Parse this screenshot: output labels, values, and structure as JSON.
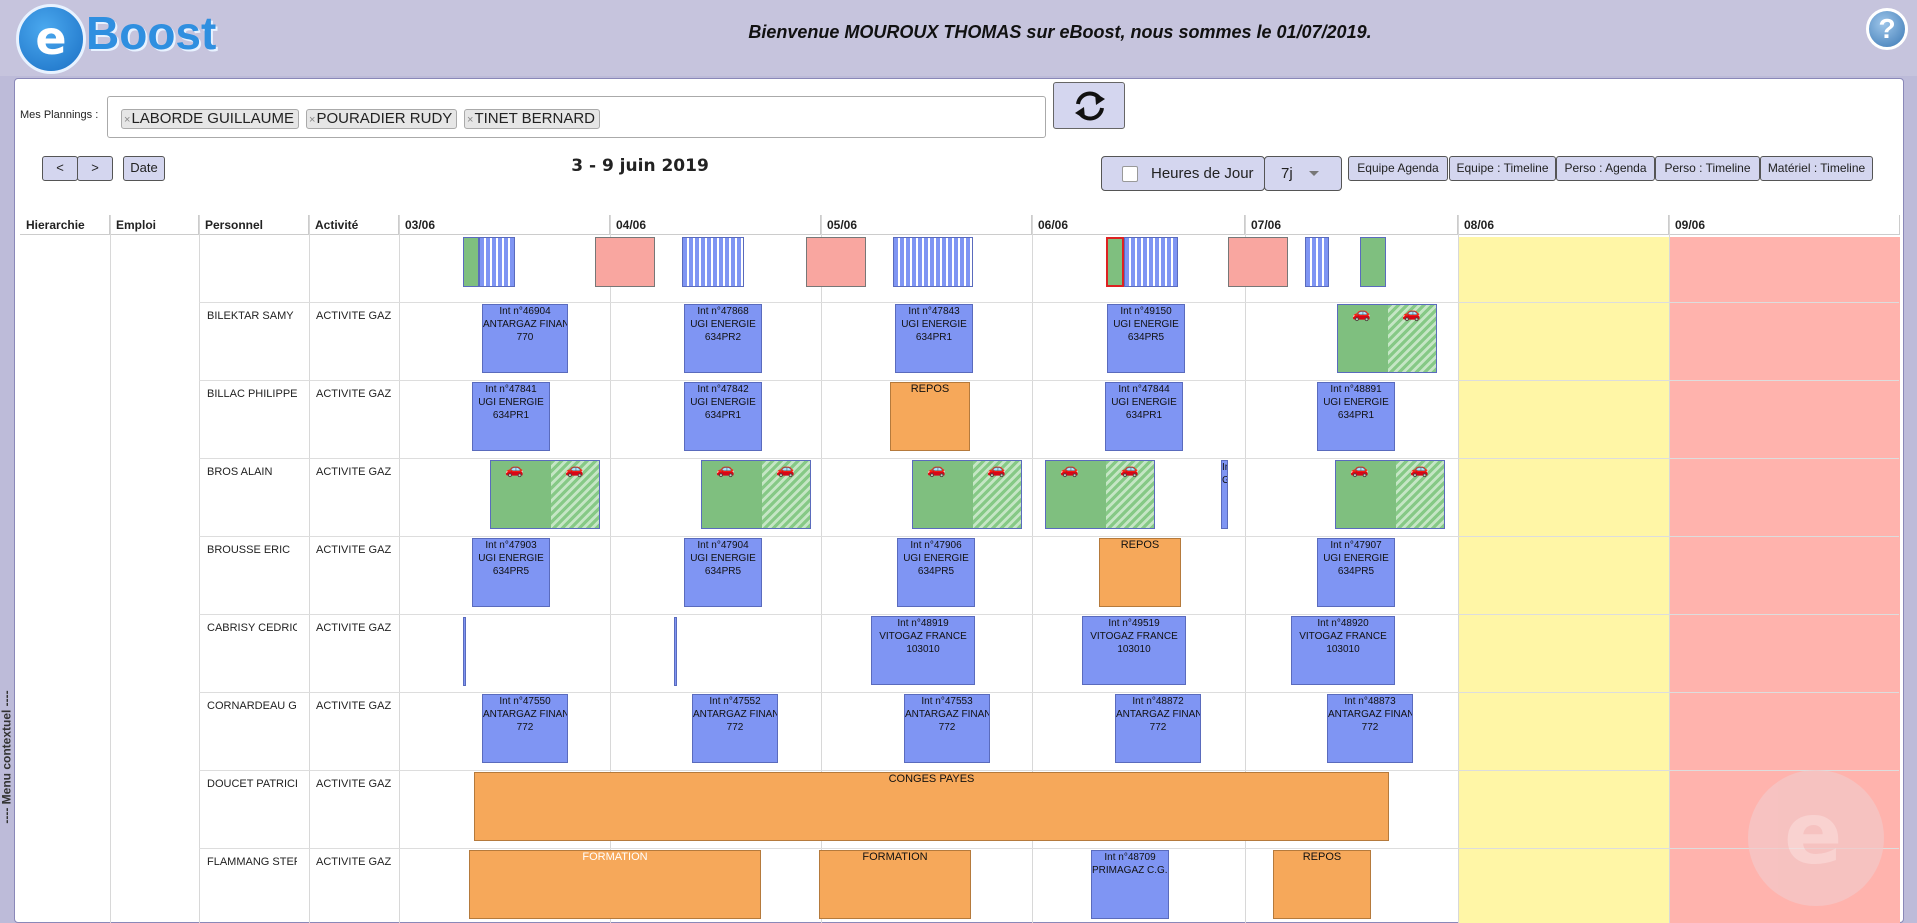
{
  "header": {
    "logo_letter": "e",
    "logo_text": "Boost",
    "welcome": "Bienvenue MOUROUX THOMAS sur eBoost, nous sommes le 01/07/2019.",
    "help_label": "?"
  },
  "side_menu": {
    "label": "---- Menu contextuel ----"
  },
  "plannings": {
    "label": "Mes Plannings :",
    "tags": [
      "LABORDE GUILLAUME",
      "POURADIER RUDY",
      "TINET BERNARD"
    ],
    "remove_glyph": "×"
  },
  "nav": {
    "prev": "<",
    "next": ">",
    "date": "Date",
    "week_title": "3 - 9 juin 2019"
  },
  "options": {
    "heures_label": "Heures de Jour",
    "period_value": "7j"
  },
  "views": [
    "Equipe Agenda",
    "Equipe : Timeline",
    "Perso : Agenda",
    "Perso : Timeline",
    "Matériel : Timeline"
  ],
  "columns": [
    "Hierarchie",
    "Emploi",
    "Personnel",
    "Activité"
  ],
  "days": [
    "03/06",
    "04/06",
    "05/06",
    "06/06",
    "07/06",
    "08/06",
    "09/06"
  ],
  "rows": [
    {
      "name": "BILEKTAR SAMY",
      "activity": "ACTIVITE GAZ",
      "events": [
        {
          "text": [
            "Int n°46904",
            "ANTARGAZ FINAN",
            "770"
          ]
        },
        {
          "text": [
            "Int n°47868",
            "UGI ENERGIE",
            "634PR2"
          ]
        },
        {
          "text": [
            "Int n°47843",
            "UGI ENERGIE",
            "634PR1"
          ]
        },
        {
          "text": [
            "Int n°49150",
            "UGI ENERGIE",
            "634PR5"
          ]
        }
      ]
    },
    {
      "name": "BILLAC PHILIPPE",
      "activity": "ACTIVITE GAZ",
      "events": [
        {
          "text": [
            "Int n°47841",
            "UGI ENERGIE",
            "634PR1"
          ]
        },
        {
          "text": [
            "Int n°47842",
            "UGI ENERGIE",
            "634PR1"
          ]
        },
        {
          "text": [
            "REPOS"
          ]
        },
        {
          "text": [
            "Int n°47844",
            "UGI ENERGIE",
            "634PR1"
          ]
        },
        {
          "text": [
            "Int n°48891",
            "UGI ENERGIE",
            "634PR1"
          ]
        }
      ]
    },
    {
      "name": "BROS ALAIN",
      "activity": "ACTIVITE GAZ",
      "events": [
        {
          "text": [
            "In",
            "G"
          ]
        }
      ]
    },
    {
      "name": "BROUSSE ERIC",
      "activity": "ACTIVITE GAZ",
      "events": [
        {
          "text": [
            "Int n°47903",
            "UGI ENERGIE",
            "634PR5"
          ]
        },
        {
          "text": [
            "Int n°47904",
            "UGI ENERGIE",
            "634PR5"
          ]
        },
        {
          "text": [
            "Int n°47906",
            "UGI ENERGIE",
            "634PR5"
          ]
        },
        {
          "text": [
            "REPOS"
          ]
        },
        {
          "text": [
            "Int n°47907",
            "UGI ENERGIE",
            "634PR5"
          ]
        }
      ]
    },
    {
      "name": "CABRISY CEDRIC",
      "activity": "ACTIVITE GAZ",
      "events": [
        {
          "text": [
            "Int n°48919",
            "VITOGAZ FRANCE",
            "103010"
          ]
        },
        {
          "text": [
            "Int n°49519",
            "VITOGAZ FRANCE",
            "103010"
          ]
        },
        {
          "text": [
            "Int n°48920",
            "VITOGAZ FRANCE",
            "103010"
          ]
        }
      ]
    },
    {
      "name": "CORNARDEAU GUY",
      "activity": "ACTIVITE GAZ",
      "events": [
        {
          "text": [
            "Int n°47550",
            "ANTARGAZ FINAN",
            "772"
          ]
        },
        {
          "text": [
            "Int n°47552",
            "ANTARGAZ FINAN",
            "772"
          ]
        },
        {
          "text": [
            "Int n°47553",
            "ANTARGAZ FINAN",
            "772"
          ]
        },
        {
          "text": [
            "Int n°48872",
            "ANTARGAZ FINAN",
            "772"
          ]
        },
        {
          "text": [
            "Int n°48873",
            "ANTARGAZ FINAN",
            "772"
          ]
        }
      ]
    },
    {
      "name": "DOUCET PATRICE",
      "activity": "ACTIVITE GAZ",
      "events": [
        {
          "text": [
            "CONGES PAYES"
          ]
        }
      ]
    },
    {
      "name": "FLAMMANG STEPHA",
      "activity": "ACTIVITE GAZ",
      "events": [
        {
          "text": [
            "FORMATION"
          ]
        },
        {
          "text": [
            "FORMATION"
          ]
        },
        {
          "text": [
            "Int n°48709",
            "PRIMAGAZ C.G.P"
          ]
        },
        {
          "text": [
            "REPOS"
          ]
        }
      ]
    }
  ],
  "colors": {
    "intervention": "#7f95f3",
    "absence": "#f6a85a",
    "vehicle": "#7fbf7f",
    "saturday": "#fff6a6",
    "sunday": "#ffb3ad"
  }
}
